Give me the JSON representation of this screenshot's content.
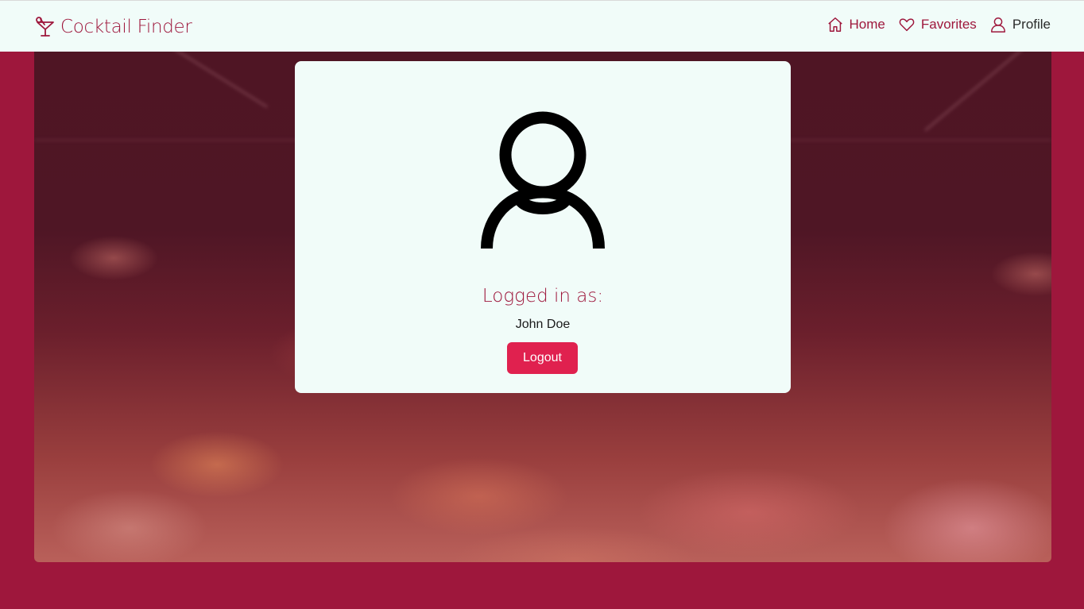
{
  "navbar": {
    "brand": "Cocktail Finder",
    "brand_icon": "cocktail-glass-icon",
    "links": [
      {
        "label": "Home",
        "icon": "home-icon"
      },
      {
        "label": "Favorites",
        "icon": "heart-icon"
      },
      {
        "label": "Profile",
        "icon": "user-icon"
      }
    ],
    "active_link": "Profile"
  },
  "profile_card": {
    "avatar_icon": "user-avatar-icon",
    "logged_in_label": "Logged in as:",
    "username": "John Doe",
    "logout_label": "Logout"
  },
  "colors": {
    "primary": "#9e173c",
    "button": "#e0214f",
    "surface": "#f1fcf9"
  }
}
